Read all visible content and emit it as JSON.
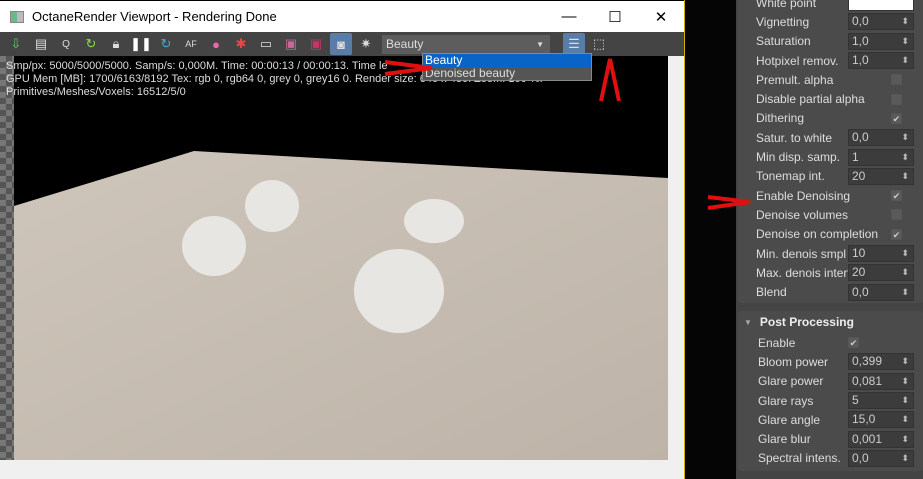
{
  "window": {
    "title": "OctaneRender Viewport - Rendering Done",
    "minimize": "—",
    "maximize": "☐",
    "close": "✕"
  },
  "toolbar": {
    "icons": [
      "export-icon",
      "copy-icon",
      "zoom-q-icon",
      "restart-icon",
      "lock-icon",
      "pause-icon",
      "refresh-icon",
      "autofocus-icon",
      "color-picker-icon",
      "region-icon",
      "display-icon",
      "film-icon",
      "film-region-icon",
      "camera-icon",
      "settings-icon"
    ],
    "pass_select": "Beauty",
    "pass_options": [
      "Beauty",
      "Denoised beauty"
    ],
    "selected_option": "Beauty"
  },
  "info": {
    "line1": "Smp/px: 5000/5000/5000.   Samp/s: 0,000M.   Time: 00:00:13 / 00:00:13.   Time le",
    "line2": "GPU Mem [MB]: 1700/6163/8192   Tex: rgb 0, rgb64 0, grey 0, grey16 0.   Render size: 640 x 480.   Zoom: 100 %.",
    "line3": "Primitives/Meshes/Voxels: 16512/5/0"
  },
  "panel": {
    "top_rows": [
      {
        "label": "White point",
        "type": "color"
      },
      {
        "label": "Vignetting",
        "value": "0,0"
      },
      {
        "label": "Saturation",
        "value": "1,0"
      },
      {
        "label": "Hotpixel remov.",
        "value": "1,0"
      },
      {
        "label": "Premult. alpha",
        "checked": false
      },
      {
        "label": "Disable partial alpha",
        "checked": false
      },
      {
        "label": "Dithering",
        "checked": true
      },
      {
        "label": "Satur. to white",
        "value": "0,0"
      },
      {
        "label": "Min disp. samp.",
        "value": "1"
      },
      {
        "label": "Tonemap int.",
        "value": "20"
      },
      {
        "label": "Enable Denoising",
        "checked": true
      },
      {
        "label": "Denoise volumes",
        "checked": false
      },
      {
        "label": "Denoise on completion",
        "checked": true
      },
      {
        "label": "Min. denois smpl",
        "value": "10"
      },
      {
        "label": "Max. denois interv",
        "value": "20"
      },
      {
        "label": "Blend",
        "value": "0,0"
      }
    ],
    "post_title": "Post Processing",
    "post_rows": [
      {
        "label": "Enable",
        "checked": true
      },
      {
        "label": "Bloom power",
        "value": "0,399"
      },
      {
        "label": "Glare power",
        "value": "0,081"
      },
      {
        "label": "Glare rays",
        "value": "5"
      },
      {
        "label": "Glare angle",
        "value": "15,0"
      },
      {
        "label": "Glare blur",
        "value": "0,001"
      },
      {
        "label": "Spectral intens.",
        "value": "0,0"
      }
    ]
  },
  "colors": {
    "annotation": "#e01010",
    "accent": "#0a64c8"
  }
}
